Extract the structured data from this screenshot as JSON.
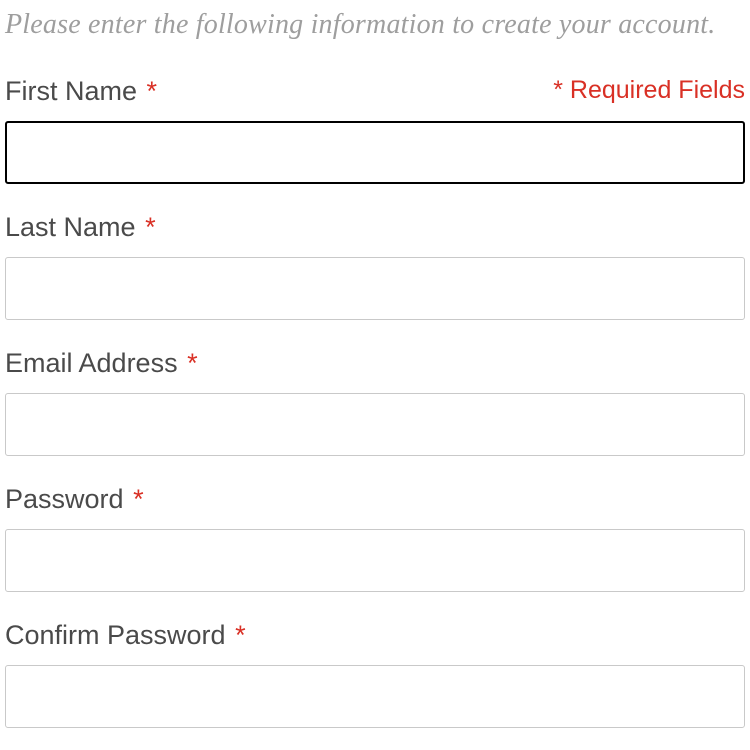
{
  "intro": "Please enter the following information to create your account.",
  "required_note": "* Required Fields",
  "fields": {
    "first_name": {
      "label": "First Name",
      "value": ""
    },
    "last_name": {
      "label": "Last Name",
      "value": ""
    },
    "email": {
      "label": "Email Address",
      "value": ""
    },
    "password": {
      "label": "Password",
      "value": ""
    },
    "confirm_password": {
      "label": "Confirm Password",
      "value": ""
    }
  },
  "asterisk": "*"
}
